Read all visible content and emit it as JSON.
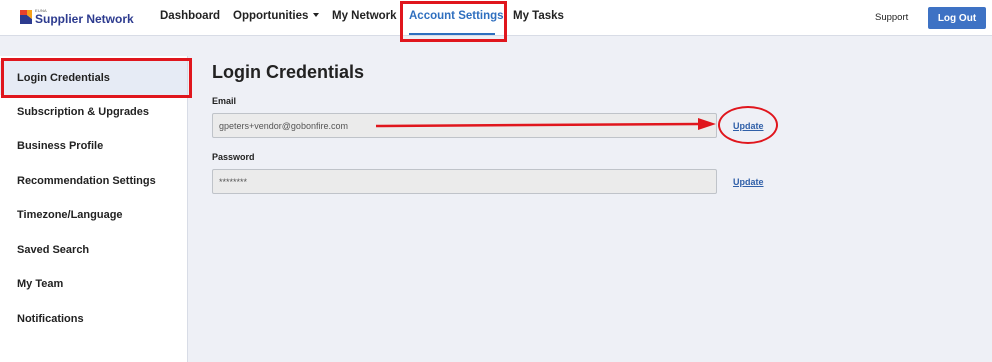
{
  "brand": {
    "small_text": "EUNA",
    "name": "Supplier Network",
    "colors": {
      "accent": "#2f6fbf",
      "brand_text": "#2d3b8f",
      "logout_bg": "#3e72c4",
      "annotation": "#e0161d"
    }
  },
  "nav": {
    "items": [
      {
        "label": "Dashboard"
      },
      {
        "label": "Opportunities",
        "has_dropdown": true
      },
      {
        "label": "My Network"
      },
      {
        "label": "Account Settings",
        "active": true
      },
      {
        "label": "My Tasks"
      }
    ],
    "support_label": "Support",
    "logout_label": "Log Out"
  },
  "sidebar": {
    "items": [
      {
        "label": "Login Credentials",
        "active": true
      },
      {
        "label": "Subscription & Upgrades"
      },
      {
        "label": "Business Profile"
      },
      {
        "label": "Recommendation Settings"
      },
      {
        "label": "Timezone/Language"
      },
      {
        "label": "Saved Search"
      },
      {
        "label": "My Team"
      },
      {
        "label": "Notifications"
      }
    ]
  },
  "main": {
    "title": "Login Credentials",
    "email": {
      "label": "Email",
      "value": "gpeters+vendor@gobonfire.com",
      "action": "Update"
    },
    "password": {
      "label": "Password",
      "value": "********",
      "action": "Update"
    }
  }
}
